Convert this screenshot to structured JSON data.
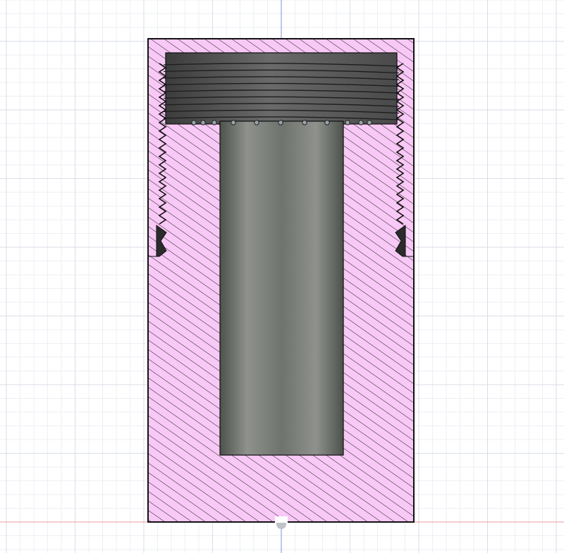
{
  "viewport": {
    "background": "#ffffff",
    "grid_minor_color": "#eceff3",
    "grid_major_color": "#d9dee6",
    "axis_vertical_color": "#7f8fe0",
    "axis_horizontal_color": "#ef9a9a"
  },
  "section_view": {
    "hatch_fill": "#f8c8f6",
    "hatch_line": "#1a1a1a",
    "outline": "#111111",
    "bore_surface": [
      "#4d524c",
      "#8f928c",
      "#6f736d",
      "#8f928c",
      "#4d524c"
    ],
    "thread_surface": [
      "#3c3c3c",
      "#6a6a6a",
      "#4a4a4a"
    ],
    "thread_profile": "internal-threaded-counterbore"
  },
  "origin": {
    "icon": "origin-point-icon"
  }
}
